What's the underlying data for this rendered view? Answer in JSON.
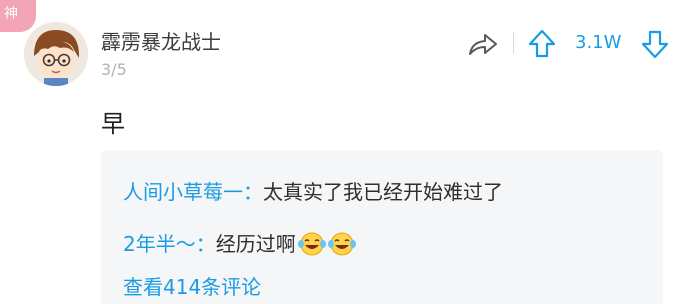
{
  "badge": {
    "label": "神"
  },
  "post": {
    "username": "霹雳暴龙战士",
    "floor": "3/5",
    "vote_count": "3.1W",
    "comment": "早"
  },
  "replies": [
    {
      "author": "人间小草莓一",
      "separator": "：",
      "text": "太真实了我已经开始难过了",
      "emoji": []
    },
    {
      "author": "2年半～",
      "separator": "：",
      "text": "经历过啊",
      "emoji": [
        "laughing-tears-emoji",
        "laughing-tears-emoji"
      ]
    }
  ],
  "view_more": "查看414条评论",
  "colors": {
    "accent_blue": "#1a9ce4",
    "badge_pink": "#f3a5b6",
    "reply_bg": "#f5f6f8",
    "username": "#3d3d3d",
    "meta_gray": "#b3b3b3"
  },
  "icons": {
    "share": "share-arrow-icon",
    "upvote": "upvote-arrow-icon",
    "downvote": "downvote-arrow-icon"
  }
}
